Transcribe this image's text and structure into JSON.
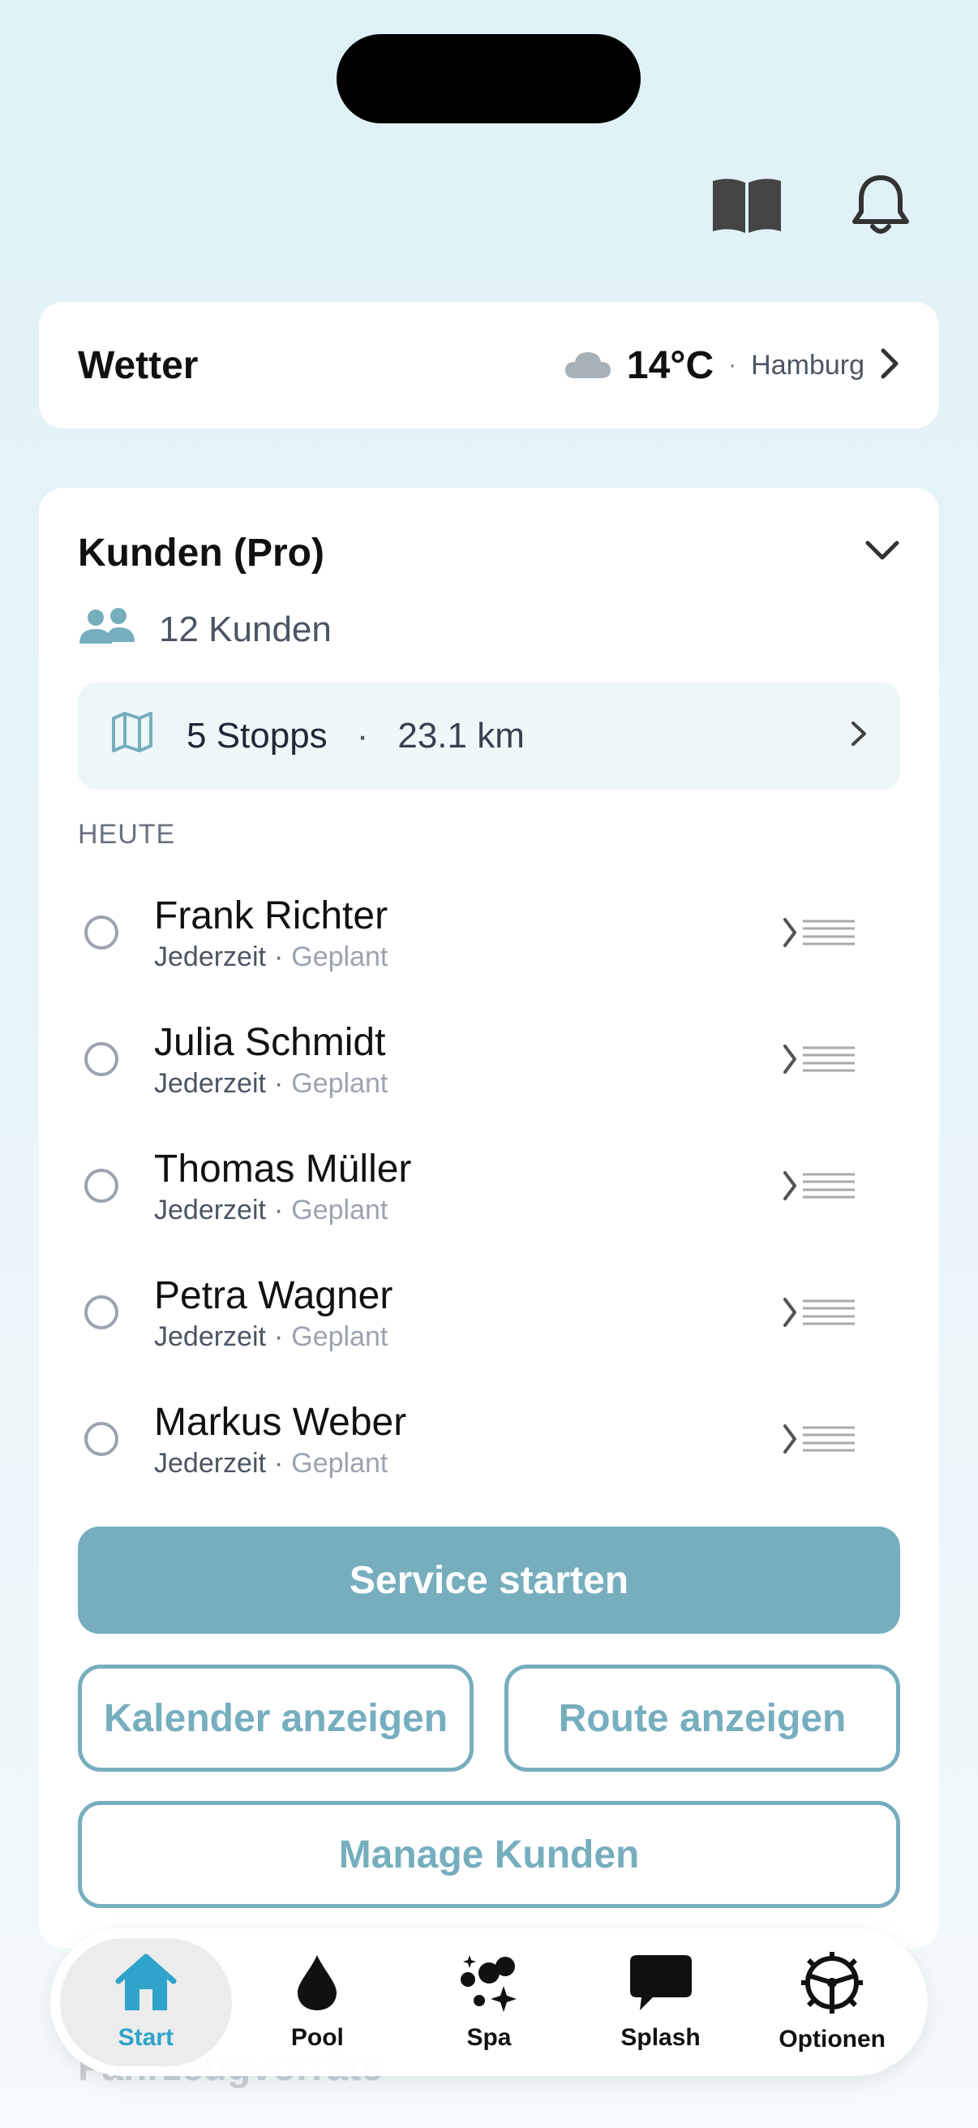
{
  "weather": {
    "title": "Wetter",
    "temperature": "14°C",
    "separator": "·",
    "city": "Hamburg",
    "icon": "cloud-icon"
  },
  "customers": {
    "title": "Kunden (Pro)",
    "count_label": "12 Kunden",
    "route": {
      "stops": "5 Stopps",
      "separator": "·",
      "distance": "23.1 km"
    },
    "section_label": "HEUTE",
    "items": [
      {
        "name": "Frank Richter",
        "time": "Jederzeit",
        "separator": "·",
        "status": "Geplant"
      },
      {
        "name": "Julia Schmidt",
        "time": "Jederzeit",
        "separator": "·",
        "status": "Geplant"
      },
      {
        "name": "Thomas Müller",
        "time": "Jederzeit",
        "separator": "·",
        "status": "Geplant"
      },
      {
        "name": "Petra Wagner",
        "time": "Jederzeit",
        "separator": "·",
        "status": "Geplant"
      },
      {
        "name": "Markus Weber",
        "time": "Jederzeit",
        "separator": "·",
        "status": "Geplant"
      }
    ],
    "buttons": {
      "start_service": "Service starten",
      "show_calendar": "Kalender anzeigen",
      "show_route": "Route anzeigen",
      "manage": "Manage Kunden"
    }
  },
  "next_section": {
    "title": "Fahrzeugvorräte"
  },
  "tabs": [
    {
      "label": "Start",
      "icon": "home-icon",
      "active": true
    },
    {
      "label": "Pool",
      "icon": "drop-icon",
      "active": false
    },
    {
      "label": "Spa",
      "icon": "bubbles-icon",
      "active": false
    },
    {
      "label": "Splash",
      "icon": "chat-bubble-icon",
      "active": false
    },
    {
      "label": "Optionen",
      "icon": "steering-wheel-icon",
      "active": false
    }
  ],
  "colors": {
    "accent": "#76aebe",
    "tab_active": "#2fa3c9",
    "background": "#dff1f6"
  }
}
